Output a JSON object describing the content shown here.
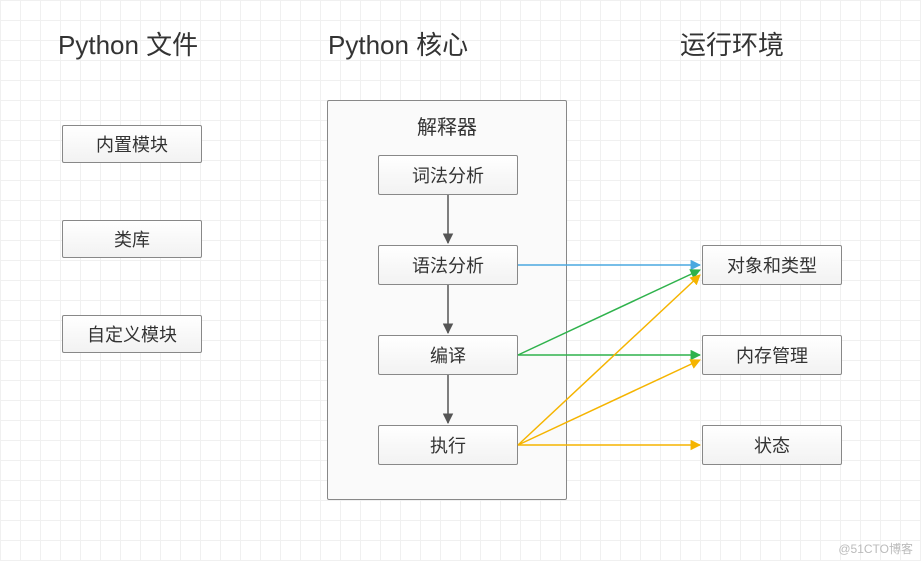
{
  "headings": {
    "left": "Python 文件",
    "center": "Python 核心",
    "right": "运行环境"
  },
  "left_nodes": {
    "builtin": "内置模块",
    "lib": "类库",
    "custom": "自定义模块"
  },
  "interpreter": {
    "title": "解释器",
    "steps": {
      "lex": "词法分析",
      "parse": "语法分析",
      "compile": "编译",
      "exec": "执行"
    }
  },
  "right_nodes": {
    "objtype": "对象和类型",
    "mem": "内存管理",
    "state": "状态"
  },
  "watermark": "@51CTO博客",
  "colors": {
    "black": "#555555",
    "blue": "#4aa8e0",
    "green": "#2fb24c",
    "yellow": "#f5b400"
  }
}
